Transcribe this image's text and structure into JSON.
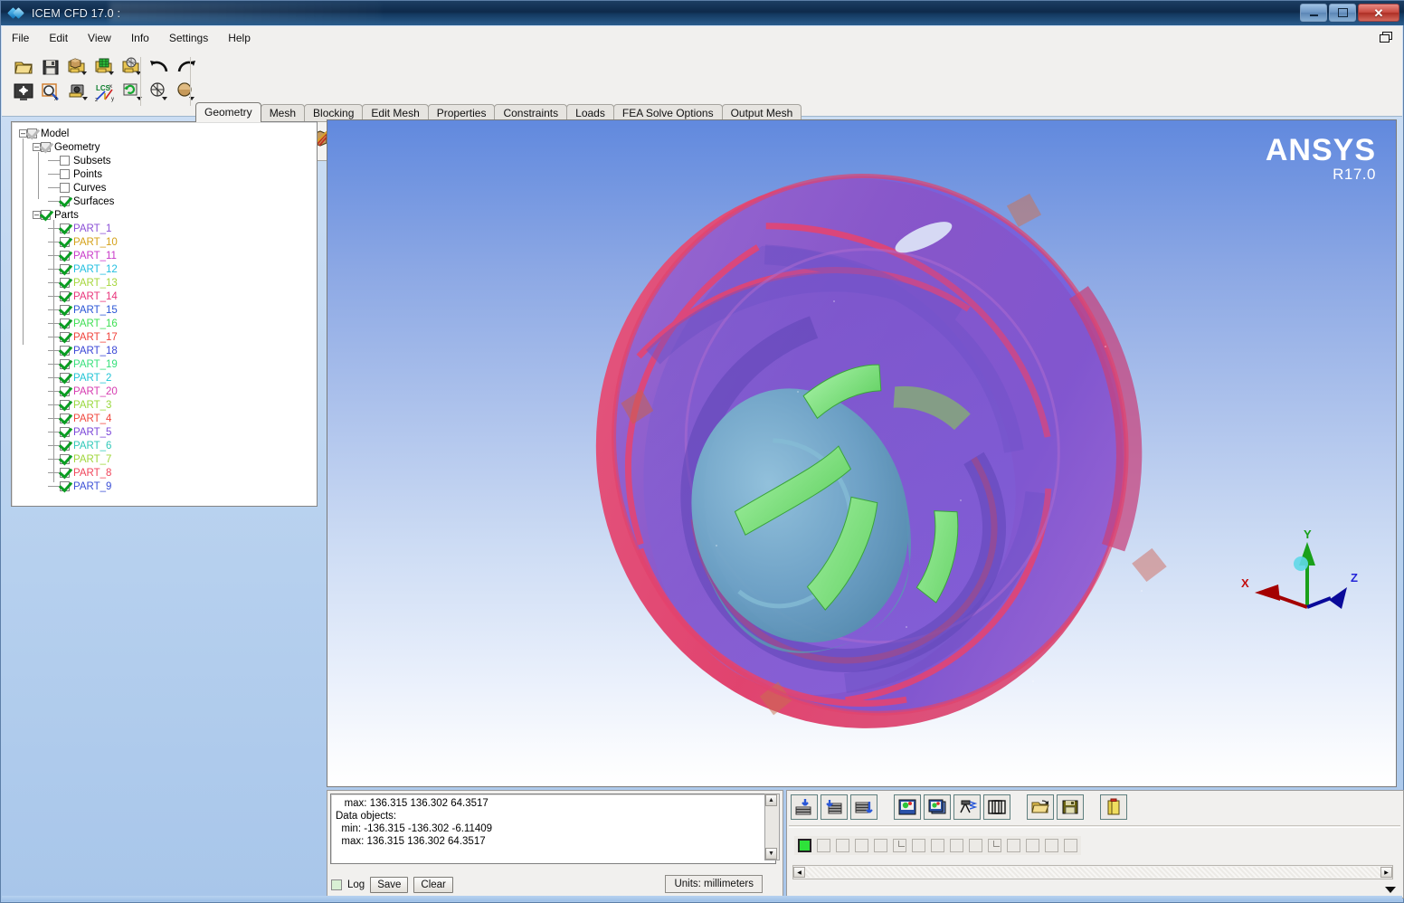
{
  "window": {
    "title": "ICEM CFD 17.0 :",
    "app_icon": "ansys-diamond-icon",
    "minimize": "minimize-icon",
    "maximize": "maximize-icon",
    "close": "close-icon"
  },
  "menu": {
    "items": [
      "File",
      "Edit",
      "View",
      "Info",
      "Settings",
      "Help"
    ],
    "restore_icon": "restore-window-icon"
  },
  "toolbar": {
    "file_group": [
      {
        "name": "open-project-icon",
        "glyph": "folder"
      },
      {
        "name": "save-project-icon",
        "glyph": "floppy"
      },
      {
        "name": "open-geometry-icon",
        "glyph": "folder-geom"
      },
      {
        "name": "open-mesh-icon",
        "glyph": "folder-mesh"
      },
      {
        "name": "open-blocking-icon",
        "glyph": "folder-blk"
      }
    ],
    "view_group": [
      {
        "name": "fit-window-icon",
        "glyph": "fit"
      },
      {
        "name": "zoom-box-icon",
        "glyph": "zoom"
      },
      {
        "name": "save-picture-icon",
        "glyph": "camera"
      },
      {
        "name": "local-coord-system-icon",
        "glyph": "lcs"
      },
      {
        "name": "refresh-view-icon",
        "glyph": "refresh"
      }
    ],
    "undo_group": [
      {
        "name": "undo-icon",
        "glyph": "undo"
      },
      {
        "name": "redo-icon",
        "glyph": "redo"
      }
    ],
    "display_group": [
      {
        "name": "wireframe-display-icon",
        "glyph": "wire"
      },
      {
        "name": "solid-display-icon",
        "glyph": "solid"
      }
    ],
    "geometry_tools": [
      {
        "name": "create-point-icon"
      },
      {
        "name": "create-curve-icon"
      },
      {
        "name": "create-surface-icon"
      },
      {
        "name": "create-body-icon"
      },
      {
        "name": "repair-geometry-icon"
      },
      {
        "name": "geometry-transform-icon"
      },
      {
        "name": "restore-dormant-icon"
      },
      {
        "name": "create-midsurface-icon"
      },
      {
        "name": "delete-point-icon"
      },
      {
        "name": "delete-curve-icon"
      },
      {
        "name": "delete-surface-icon"
      },
      {
        "name": "delete-body-icon"
      },
      {
        "name": "delete-any-icon"
      }
    ]
  },
  "tabs": {
    "items": [
      "Geometry",
      "Mesh",
      "Blocking",
      "Edit Mesh",
      "Properties",
      "Constraints",
      "Loads",
      "FEA Solve Options",
      "Output Mesh"
    ],
    "active": "Geometry"
  },
  "tree": {
    "root": {
      "label": "Model",
      "checked": "dim",
      "expanded": true
    },
    "geometry": {
      "label": "Geometry",
      "checked": "dim",
      "expanded": true,
      "children": [
        {
          "label": "Subsets",
          "checked": "off",
          "color": "#000000"
        },
        {
          "label": "Points",
          "checked": "off",
          "color": "#000000"
        },
        {
          "label": "Curves",
          "checked": "off",
          "color": "#000000"
        },
        {
          "label": "Surfaces",
          "checked": "on",
          "color": "#000000"
        }
      ]
    },
    "parts": {
      "label": "Parts",
      "checked": "on",
      "expanded": true,
      "children": [
        {
          "label": "PART_1",
          "checked": "on",
          "color": "#8a4fd6"
        },
        {
          "label": "PART_10",
          "checked": "on",
          "color": "#d4a017"
        },
        {
          "label": "PART_11",
          "checked": "on",
          "color": "#c837c8"
        },
        {
          "label": "PART_12",
          "checked": "on",
          "color": "#22bfe0"
        },
        {
          "label": "PART_13",
          "checked": "on",
          "color": "#a6d63a"
        },
        {
          "label": "PART_14",
          "checked": "on",
          "color": "#e8337a"
        },
        {
          "label": "PART_15",
          "checked": "on",
          "color": "#2a56d6"
        },
        {
          "label": "PART_16",
          "checked": "on",
          "color": "#3ddf52"
        },
        {
          "label": "PART_17",
          "checked": "on",
          "color": "#f0423a"
        },
        {
          "label": "PART_18",
          "checked": "on",
          "color": "#3a46d6"
        },
        {
          "label": "PART_19",
          "checked": "on",
          "color": "#35e07a"
        },
        {
          "label": "PART_2",
          "checked": "on",
          "color": "#22c4d6"
        },
        {
          "label": "PART_20",
          "checked": "on",
          "color": "#d63ab0"
        },
        {
          "label": "PART_3",
          "checked": "on",
          "color": "#98d83a"
        },
        {
          "label": "PART_4",
          "checked": "on",
          "color": "#f0473d"
        },
        {
          "label": "PART_5",
          "checked": "on",
          "color": "#7a45d8"
        },
        {
          "label": "PART_6",
          "checked": "on",
          "color": "#2ec8b8"
        },
        {
          "label": "PART_7",
          "checked": "on",
          "color": "#9fd63a"
        },
        {
          "label": "PART_8",
          "checked": "on",
          "color": "#f0445a"
        },
        {
          "label": "PART_9",
          "checked": "on",
          "color": "#3a4fd6"
        }
      ]
    }
  },
  "viewport": {
    "logo_main": "ANSYS",
    "logo_release": "R17.0",
    "background_top_color": "#6189de",
    "background_bottom_color": "#ffffff",
    "triad": {
      "x_label": "X",
      "y_label": "Y",
      "z_label": "Z",
      "x_color": "#c00000",
      "y_color": "#00a000",
      "z_color": "#0000c0"
    },
    "model": {
      "name": "centrifugal-pump-impeller",
      "shroud_color": "#7b5fd0",
      "rim_color": "#e0436e",
      "hub_color": "#6ea8c4",
      "blade_highlight_color": "#6fdc6f"
    }
  },
  "message_panel": {
    "lines": [
      "   max: 136.315 136.302 64.3517",
      "Data objects:",
      "  min: -136.315 -136.302 -6.11409",
      "  max: 136.315 136.302 64.3517"
    ],
    "log_checkbox_label": "Log",
    "save_label": "Save",
    "clear_label": "Clear",
    "units_label": "Units: millimeters",
    "scroll_up_icon": "scroll-up-arrow-icon",
    "scroll_down_icon": "scroll-down-arrow-icon"
  },
  "bottom_toolbar": {
    "buttons": [
      {
        "name": "load-mesh-icon"
      },
      {
        "name": "save-mesh-icon"
      },
      {
        "name": "append-mesh-icon"
      },
      {
        "name": "view-image-icon"
      },
      {
        "name": "save-image-sequence-icon"
      },
      {
        "name": "camera-view-icon"
      },
      {
        "name": "fit-view-icon"
      },
      {
        "name": "open-file-icon"
      },
      {
        "name": "save-file-icon"
      },
      {
        "name": "notes-icon"
      }
    ],
    "swatches": [
      {
        "selected": true,
        "corner": false
      },
      {
        "selected": false,
        "corner": false
      },
      {
        "selected": false,
        "corner": false
      },
      {
        "selected": false,
        "corner": false
      },
      {
        "selected": false,
        "corner": false
      },
      {
        "selected": false,
        "corner": true
      },
      {
        "selected": false,
        "corner": false
      },
      {
        "selected": false,
        "corner": false
      },
      {
        "selected": false,
        "corner": false
      },
      {
        "selected": false,
        "corner": false
      },
      {
        "selected": false,
        "corner": true
      },
      {
        "selected": false,
        "corner": false
      },
      {
        "selected": false,
        "corner": false
      },
      {
        "selected": false,
        "corner": false
      },
      {
        "selected": false,
        "corner": false
      }
    ],
    "selected_swatch_color": "#2ee23a",
    "hscroll_left_icon": "scroll-left-arrow-icon",
    "hscroll_right_icon": "scroll-right-arrow-icon",
    "expand_icon": "expand-down-arrow-icon"
  }
}
